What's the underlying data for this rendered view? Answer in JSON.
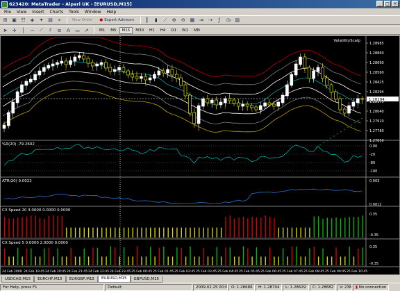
{
  "window": {
    "title": "623420: MetaTrader - Alpari UK - [EURUSD,M15]"
  },
  "menu": [
    "File",
    "View",
    "Insert",
    "Charts",
    "Tools",
    "Window",
    "Help"
  ],
  "toolbar": {
    "new_order": "New Order",
    "expert_advisors": "Expert Advisors"
  },
  "timeframes": [
    "M1",
    "M5",
    "M15",
    "M30",
    "H1",
    "H4",
    "D1",
    "W1",
    "MN"
  ],
  "active_timeframe": "M15",
  "chart": {
    "indicator_label": "VolatilityScalp",
    "price_ticks": [
      "1.28985",
      "1.28860",
      "1.28690",
      "1.28560",
      "1.28425",
      "1.28294",
      "1.28175",
      "1.28040",
      "1.27910",
      "1.27780",
      "1.27650"
    ],
    "current_price": "1.28294",
    "wpr": {
      "title": "%R(20) -79.2602",
      "levels": [
        "0.00",
        "-20",
        "-80",
        "-100"
      ]
    },
    "atr": {
      "title": "ATR(20) 0.0022",
      "levels": [
        "0.003",
        "0.0012"
      ]
    },
    "cx1": {
      "title": "CX Speed 20 3.0000 0.0000 0.0000",
      "levels": [
        "0.35",
        "-0.35"
      ]
    },
    "cx2": {
      "title": "CX Speed 5 0.0000 2.0000 0.0000",
      "levels": [
        "0.35",
        "-0.35"
      ]
    },
    "time_ticks": [
      "24 Feb 2009",
      "24 Feb 19:45",
      "24 Feb 20:45",
      "24 Feb 21:45",
      "24 Feb 22:45",
      "24 Feb 23:45",
      "25 Feb 00:45",
      "25 Feb 01:45",
      "25 Feb 02:45",
      "25 Feb 03:45",
      "25 Feb 04:45",
      "25 Feb 05:45",
      "25 Feb 06:45",
      "25 Feb 07:45",
      "25 Feb 08:45",
      "25 Feb 09:45",
      "25 Feb 10:45"
    ]
  },
  "tabs": [
    "USDCAD,M15",
    "EURCHF,M15",
    "EURGBP,M15",
    "EURUSD,M15",
    "GBPUSD,M15"
  ],
  "active_tab": "EURUSD,M15",
  "status": {
    "help": "For Help, press F1",
    "profile": "Default",
    "datetime": "2009.02.25 00:00",
    "open": "O: 1.28686",
    "high": "H: 1.28704",
    "low": "L: 1.28629",
    "close": "C: 1.28682",
    "volume": "V: 238",
    "connection": "No connection"
  },
  "colors": {
    "up_bar": "#ffffff",
    "down_bar": "#ffff00",
    "green_hist": "#00c000",
    "red_hist": "#e00000",
    "yellow_hist": "#e0e000"
  }
}
